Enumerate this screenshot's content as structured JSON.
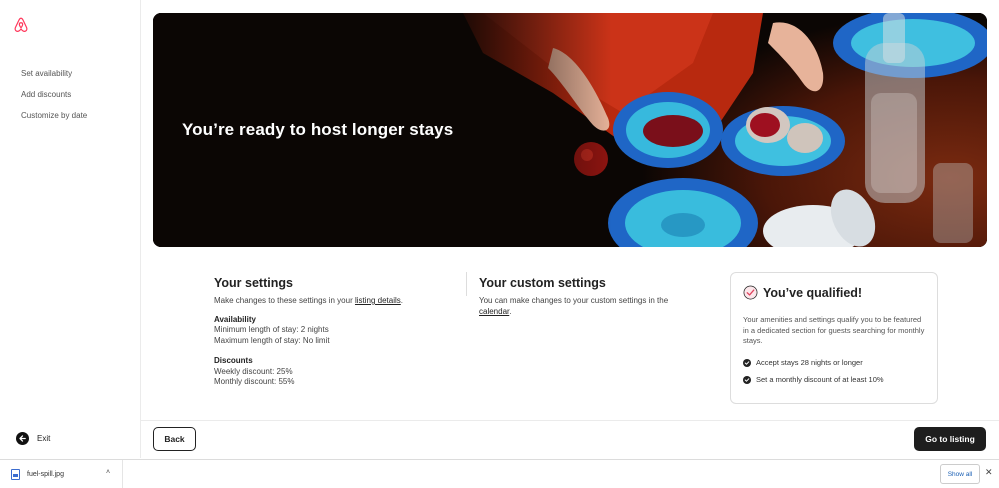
{
  "sidebar": {
    "items": [
      {
        "label": "Set availability"
      },
      {
        "label": "Add discounts"
      },
      {
        "label": "Customize by date"
      }
    ],
    "exit_label": "Exit"
  },
  "hero": {
    "title": "You’re ready to host longer stays"
  },
  "settings": {
    "title": "Your settings",
    "subtitle_prefix": "Make changes to these settings in your ",
    "subtitle_link": "listing details",
    "subtitle_suffix": ".",
    "availability": {
      "title": "Availability",
      "min_stay": "Minimum length of stay: 2 nights",
      "max_stay": "Maximum length of stay: No limit"
    },
    "discounts": {
      "title": "Discounts",
      "weekly": "Weekly discount: 25%",
      "monthly": "Monthly discount: 55%"
    }
  },
  "custom_settings": {
    "title": "Your custom settings",
    "text_prefix": "You can make changes to your custom settings in the",
    "text_link": "calendar",
    "text_suffix": "."
  },
  "qualified": {
    "title": "You’ve qualified!",
    "body": "Your amenities and settings qualify you to be featured in a dedicated section for guests searching for monthly stays.",
    "checks": [
      {
        "text": "Accept stays 28 nights or longer"
      },
      {
        "text": "Set a monthly discount of at least 10%"
      }
    ]
  },
  "footer": {
    "back_label": "Back",
    "go_label": "Go to listing"
  },
  "download_bar": {
    "file_name": "fuel-spill.jpg",
    "show_all_label": "Show all"
  },
  "colors": {
    "brand": "#FF385C",
    "primary_button": "#1e1e1e"
  }
}
